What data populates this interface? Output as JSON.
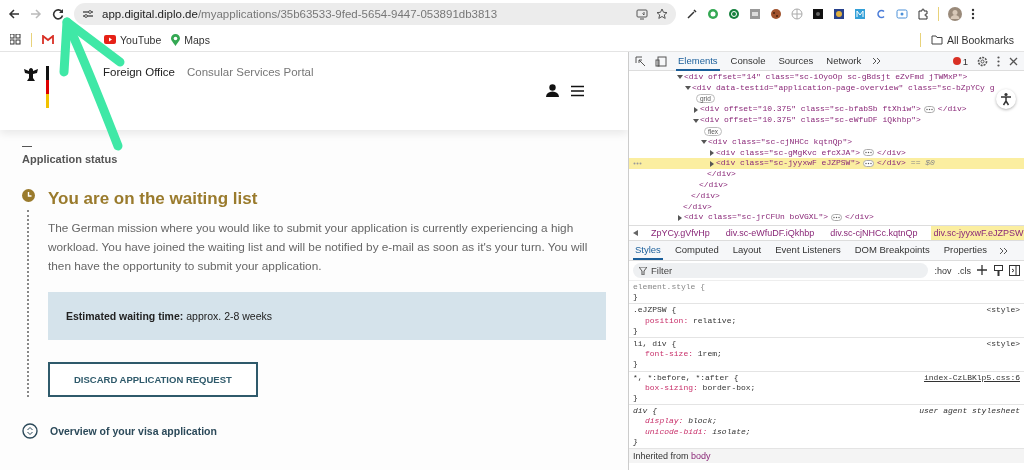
{
  "browser": {
    "url_host": "app.digital.diplo.de",
    "url_path": "/myapplications/35b63533-9fed-5654-9447-053891db3813",
    "bookmarks": [
      {
        "label": "YouTube",
        "kind": "youtube"
      },
      {
        "label": "Maps",
        "kind": "maps"
      }
    ],
    "all_bookmarks": "All Bookmarks"
  },
  "page": {
    "brand": "Foreign Office",
    "portal": "Consular Services Portal",
    "section_label": "Application status",
    "status": {
      "title": "You are on the waiting list",
      "body": "The German mission where you would like to submit your application is currently experiencing a high workload. You have joined the waiting list and will be notified by e-mail as soon as it's your turn. You will then have the opportunity to submit your application.",
      "info": "**Estimated waiting time:** approx. 2-8 weeks",
      "button": "DISCARD APPLICATION REQUEST"
    },
    "overview": "Overview of your visa application"
  },
  "devtools": {
    "tabs": [
      {
        "label": "Elements",
        "selected": true
      },
      {
        "label": "Console",
        "selected": false
      },
      {
        "label": "Sources",
        "selected": false
      },
      {
        "label": "Network",
        "selected": false
      }
    ],
    "error_count": "1",
    "dom": [
      {
        "open": "<div offset=\"14\" class=\"sc-iOyoOp sc-gBdsjt eZvFmd jTWMxP\">",
        "expanded": true,
        "selected": false,
        "close": "</div>",
        "children": [
          {
            "open": "<div data-testid=\"application-page-overview\" class=\"sc-bZpYCy g",
            "expanded": true,
            "selected": false,
            "badge": "grid",
            "close": "</div>",
            "children": [
              {
                "open": "<div offset=\"10.375\" class=\"sc-bfabSb ftXhiw\">",
                "expanded": false,
                "selected": false,
                "close": "</div>"
              },
              {
                "open": "<div offset=\"10.375\" class=\"sc-eWfuDF iQkhbp\">",
                "expanded": true,
                "selected": false,
                "badge": "flex",
                "close": "</div>",
                "children": [
                  {
                    "open": "<div class=\"sc-cjNHCc kqtnQp\">",
                    "expanded": true,
                    "selected": false,
                    "close": "</div>",
                    "children": [
                      {
                        "open": "<div class=\"sc-gMgKvc efcXJA\">",
                        "expanded": false,
                        "selected": false,
                        "close": "</div>"
                      },
                      {
                        "open": "<div class=\"sc-jyyxwF eJZPSW\">",
                        "expanded": false,
                        "selected": true,
                        "close": "</div>",
                        "suffix": "== $0"
                      }
                    ]
                  }
                ]
              }
            ]
          }
        ]
      },
      {
        "open": "<div class=\"sc-jrCFUn boVGXL\">",
        "expanded": false,
        "selected": false,
        "close": "</div>"
      }
    ],
    "breadcrumbs": [
      {
        "label": "ZpYCy.gVfvHp",
        "selected": false
      },
      {
        "label": "div.sc-eWfuDF.iQkhbp",
        "selected": false
      },
      {
        "label": "div.sc-cjNHCc.kqtnQp",
        "selected": false
      },
      {
        "label": "div.sc-jyyxwF.eJZPSW",
        "selected": true
      }
    ],
    "style_tabs": [
      {
        "label": "Styles",
        "selected": true
      },
      {
        "label": "Computed",
        "selected": false
      },
      {
        "label": "Layout",
        "selected": false
      },
      {
        "label": "Event Listeners",
        "selected": false
      },
      {
        "label": "DOM Breakpoints",
        "selected": false
      },
      {
        "label": "Properties",
        "selected": false
      }
    ],
    "filter": {
      "placeholder": "Filter"
    },
    "hov": ":hov",
    "cls": ".cls",
    "rules": [
      {
        "selector": "element.style {",
        "kind": "inline",
        "close": "}"
      },
      {
        "selector": ".eJZPSW {",
        "kind": "author",
        "source": "<style>",
        "close": "}",
        "declarations": [
          {
            "property": "position:",
            "value": "relative;"
          }
        ]
      },
      {
        "selector": "li, div {",
        "kind": "author",
        "source": "<style>",
        "close": "}",
        "declarations": [
          {
            "property": "font-size:",
            "value": "1rem;"
          }
        ]
      },
      {
        "selector": "*, *:before, *:after {",
        "kind": "author",
        "source": "index-CzLBKlp5.css:6",
        "close": "}",
        "declarations": [
          {
            "property": "box-sizing:",
            "value": "border-box;"
          }
        ]
      },
      {
        "selector": "div {",
        "kind": "user-agent",
        "source": "user agent stylesheet",
        "close": "}",
        "declarations": [
          {
            "property": "display:",
            "value": "block;"
          },
          {
            "property": "unicode-bidi:",
            "value": "isolate;"
          }
        ]
      }
    ],
    "inherited": {
      "label": "Inherited from",
      "element": "body"
    }
  }
}
